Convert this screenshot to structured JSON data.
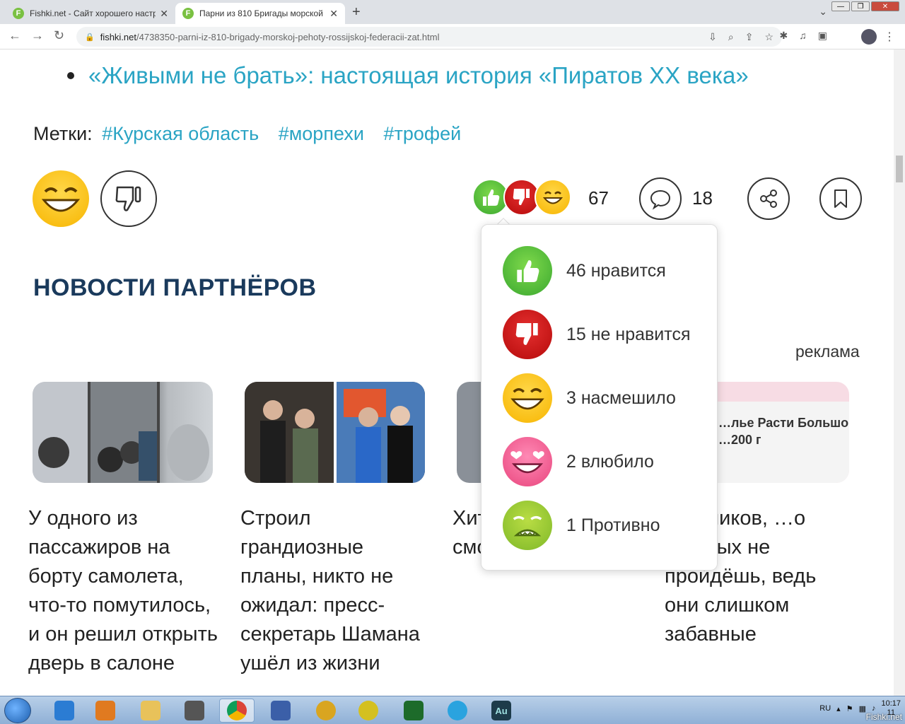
{
  "browser": {
    "tabs": [
      {
        "title": "Fishki.net - Сайт хорошего настр",
        "favicon": "F",
        "active": false
      },
      {
        "title": "Парни из 810 Бригады морской",
        "favicon": "F",
        "active": true
      }
    ],
    "new_tab": "+",
    "url_domain": "fishki.net",
    "url_path": "/4738350-parni-iz-810-brigady-morskoj-pehoty-rossijskoj-federacii-zat.html"
  },
  "article": {
    "related_link": "«Живыми не брать»: настоящая история «Пиратов XX века»",
    "tags_label": "Метки:",
    "tags": [
      "#Курская область",
      "#морпехи",
      "#трофей"
    ]
  },
  "reactions": {
    "total": "67",
    "comments": "18",
    "popup": [
      {
        "label": "46 нравится",
        "icon": "thumbs-up-icon",
        "color": "#4cb535"
      },
      {
        "label": "15 не нравится",
        "icon": "thumbs-down-icon",
        "color": "#d41818"
      },
      {
        "label": "3 насмешило",
        "icon": "laughing-face-icon",
        "color": "#f7b500"
      },
      {
        "label": "2 влюбило",
        "icon": "heart-eyes-face-icon",
        "color": "#ef5a92"
      },
      {
        "label": "1 Противно",
        "icon": "sick-face-icon",
        "color": "#94c832"
      }
    ]
  },
  "partners": {
    "title": "НОВОСТИ ПАРТНЁРОВ",
    "ad_label": "реклама",
    "cards": [
      {
        "title": "У одного из пассажиров на борту самолета, что-то помутилось, и он решил открыть дверь в салоне"
      },
      {
        "title": "Строил грандиозные планы, никто не ожидал: пресс-секретарь Шамана ушёл из жизни"
      },
      {
        "title": "Хит смо"
      },
      {
        "title": "…енников, …о которых не пройдёшь, ведь они слишком забавные"
      }
    ],
    "card4_image_text_1": "…лье Расти Большой",
    "card4_image_text_2": "…200 г"
  },
  "taskbar": {
    "lang": "RU",
    "time": "10:17",
    "date": "11",
    "watermark": "Fishki.net"
  },
  "colors": {
    "link": "#2aa4c4",
    "heading": "#1a3a5c"
  }
}
